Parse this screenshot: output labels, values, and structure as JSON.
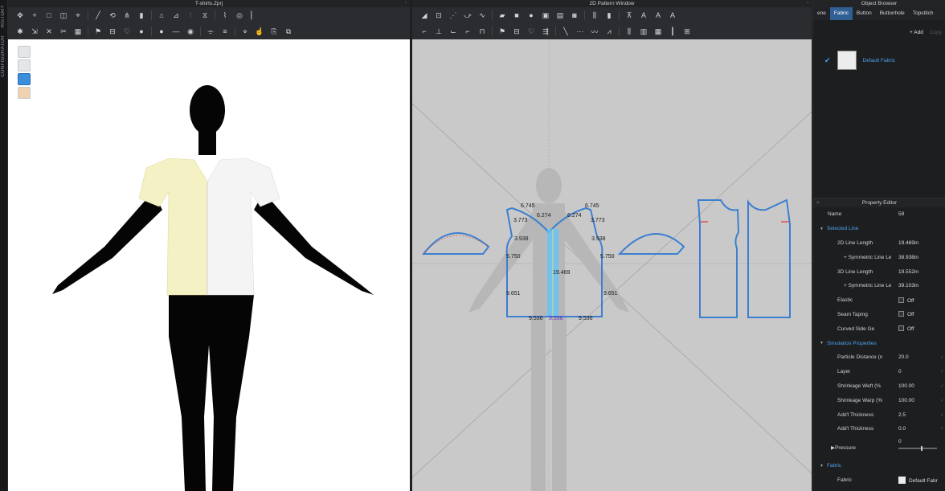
{
  "side_tabs": [
    "HISTORY",
    "CONFIGURATOR"
  ],
  "window_3d": {
    "title": "T-shirts.Zprj"
  },
  "window_2d": {
    "title": "2D Pattern Window"
  },
  "object_browser": {
    "title": "Object Browser",
    "tabs": [
      "ene",
      "Fabric",
      "Button",
      "Buttonhole",
      "Topstitch"
    ],
    "active_tab": "Fabric",
    "add_label": "+ Add",
    "copy_label": "Copy",
    "fabric_items": [
      {
        "name": "Default Fabric"
      }
    ]
  },
  "property_editor": {
    "title": "Property Editor",
    "rows": [
      {
        "type": "plain",
        "label": "Name",
        "value": "59"
      },
      {
        "type": "section",
        "label": "Selected Line"
      },
      {
        "type": "value",
        "label": "2D Line Length",
        "value": "19.469in"
      },
      {
        "type": "value",
        "label": "+ Symmetric Line Le",
        "value": "38.938in"
      },
      {
        "type": "value",
        "label": "3D Line Length",
        "value": "19.552in"
      },
      {
        "type": "value",
        "label": "+ Symmetric Line Le",
        "value": "39.103in"
      },
      {
        "type": "check",
        "label": "Elastic",
        "value": "Off"
      },
      {
        "type": "check",
        "label": "Seam Taping",
        "value": "Off"
      },
      {
        "type": "check",
        "label": "Curved Side Geome",
        "value": "Off"
      },
      {
        "type": "section",
        "label": "Simulation Properties"
      },
      {
        "type": "value",
        "label": "Particle Distance (n",
        "value": "20.0"
      },
      {
        "type": "value",
        "label": "Layer",
        "value": "0"
      },
      {
        "type": "value",
        "label": "Shrinkage Weft (%",
        "value": "100.00"
      },
      {
        "type": "value",
        "label": "Shrinkage Warp (%",
        "value": "100.00"
      },
      {
        "type": "value",
        "label": "Add'l Thickness - Collisic",
        "value": "2.5"
      },
      {
        "type": "value",
        "label": "Add'l Thickness - Render",
        "value": "0.0"
      },
      {
        "type": "slider",
        "label": "Pressure",
        "value": "0"
      },
      {
        "type": "section",
        "label": "Fabric"
      },
      {
        "type": "fabric",
        "label": "Fabric",
        "value": "Default Fabr"
      }
    ]
  },
  "pattern_measurements": {
    "front_top_left": "6.745",
    "front_top_right": "6.745",
    "neck_left": "6.274",
    "neck_right": "6.274",
    "shoulder_left": "3.773",
    "shoulder_right": "3.773",
    "armhole_left": "3.938",
    "armhole_right": "3.938",
    "side_left": "5.750",
    "side_right": "5.750",
    "center": "19.469",
    "lower_left": "9.651",
    "lower_right": "9.651",
    "hem_left": "9.536",
    "hem_center": "9.536",
    "hem_right": "9.536"
  },
  "colors": {
    "accent": "#3a8edb",
    "selected_tab": "#2f5f93",
    "pattern_outline": "#3d7fd0",
    "selected_line": "#37c0ff",
    "seam_marker": "#e03a3a",
    "garment_left": "#f4f1c4",
    "garment_right": "#f4f4f4",
    "avatar": "#050505"
  }
}
